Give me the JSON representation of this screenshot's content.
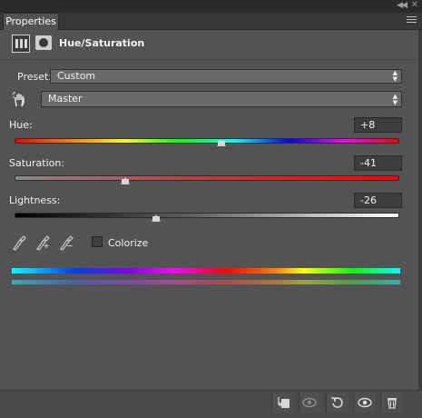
{
  "panel": {
    "tab_label": "Properties",
    "title": "Hue/Saturation"
  },
  "preset": {
    "label": "Preset:",
    "value": "Custom"
  },
  "channel": {
    "value": "Master"
  },
  "hue": {
    "label": "Hue:",
    "value": "+8",
    "slider_fraction": 0.54
  },
  "saturation": {
    "label": "Saturation:",
    "value": "-41",
    "slider_fraction": 0.29
  },
  "lightness": {
    "label": "Lightness:",
    "value": "-26",
    "slider_fraction": 0.37
  },
  "colorize": {
    "label": "Colorize",
    "checked": false
  },
  "colors": {
    "panel_bg": "#535353",
    "titlebar_bg": "#2b2b2b",
    "field_bg": "#3d3d3d"
  }
}
